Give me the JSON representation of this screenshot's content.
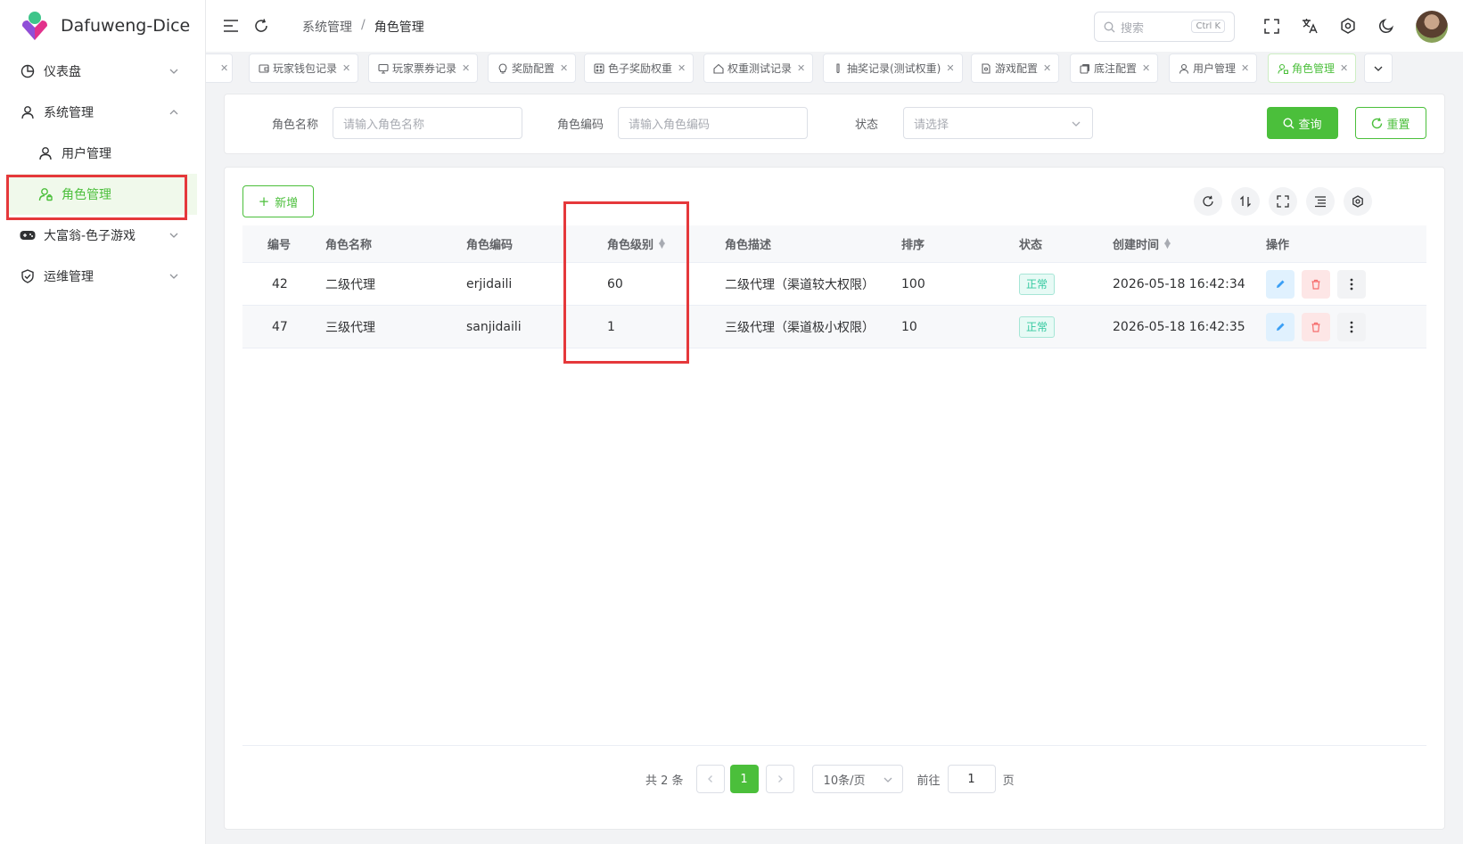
{
  "app": {
    "title": "Dafuweng-Dice"
  },
  "sidebar": {
    "items": [
      {
        "label": "仪表盘"
      },
      {
        "label": "系统管理"
      },
      {
        "label": "用户管理"
      },
      {
        "label": "角色管理"
      },
      {
        "label": "大富翁-色子游戏"
      },
      {
        "label": "运维管理"
      }
    ]
  },
  "header": {
    "breadcrumb": [
      "系统管理",
      "/",
      "角色管理"
    ],
    "search_placeholder": "搜索",
    "search_shortcut": "Ctrl K"
  },
  "tags": [
    {
      "label": "玩家钱包记录"
    },
    {
      "label": "玩家票券记录"
    },
    {
      "label": "奖励配置"
    },
    {
      "label": "色子奖励权重"
    },
    {
      "label": "权重测试记录"
    },
    {
      "label": "抽奖记录(测试权重)"
    },
    {
      "label": "游戏配置"
    },
    {
      "label": "底注配置"
    },
    {
      "label": "用户管理"
    },
    {
      "label": "角色管理"
    }
  ],
  "filters": {
    "role_name_label": "角色名称",
    "role_name_placeholder": "请输入角色名称",
    "role_code_label": "角色编码",
    "role_code_placeholder": "请输入角色编码",
    "status_label": "状态",
    "status_placeholder": "请选择",
    "query_label": "查询",
    "reset_label": "重置"
  },
  "toolbar": {
    "add_label": "新增"
  },
  "table": {
    "columns": [
      "编号",
      "角色名称",
      "角色编码",
      "角色级别",
      "角色描述",
      "排序",
      "状态",
      "创建时间",
      "操作"
    ],
    "rows": [
      {
        "id": "42",
        "name": "二级代理",
        "code": "erjidaili",
        "level": "60",
        "desc": "二级代理（渠道较大权限）",
        "sort": "100",
        "status": "正常",
        "created": "2026-05-18 16:42:34"
      },
      {
        "id": "47",
        "name": "三级代理",
        "code": "sanjidaili",
        "level": "1",
        "desc": "三级代理（渠道极小权限）",
        "sort": "10",
        "status": "正常",
        "created": "2026-05-18 16:42:35"
      }
    ]
  },
  "pagination": {
    "total_text": "共 2 条",
    "current_page": "1",
    "page_size": "10条/页",
    "goto_label": "前往",
    "goto_value": "1",
    "page_suffix": "页"
  },
  "colors": {
    "primary": "#4bbf3b",
    "highlight_box": "#e5383b",
    "status_green": "#34c9a0"
  }
}
